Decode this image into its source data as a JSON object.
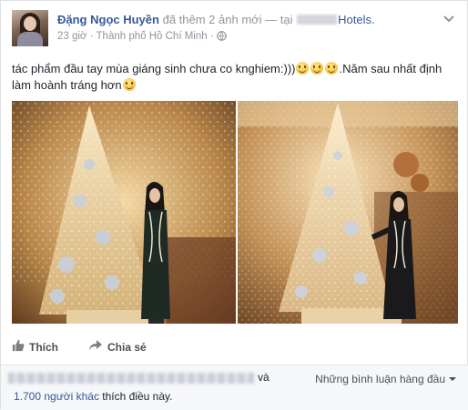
{
  "post": {
    "author": "Đặng Ngọc Huyền",
    "action_text": "đã thêm 2 ảnh mới — tại",
    "place": "Hotels.",
    "time": "23 giờ",
    "separator": "·",
    "location": "Thành phố Hồ Chí Minh",
    "privacy_icon": "globe-icon",
    "menu_icon": "chevron-down-icon",
    "text_part1": "tác phẩm đầu tay mùa giáng sinh chưa co knghiem:)))",
    "text_part2": ".Năm sau nhất định làm hoành tráng hơn",
    "emoji_icon": "grin-emoji-icon"
  },
  "photos": [
    {
      "alt_icon": "photo-christmas-tree-1"
    },
    {
      "alt_icon": "photo-christmas-tree-2"
    }
  ],
  "actions": {
    "like_label": "Thích",
    "share_label": "Chia sẻ",
    "like_icon": "thumbs-up-icon",
    "share_icon": "share-arrow-icon"
  },
  "footer": {
    "and_text": "và",
    "sort_label": "Những bình luận hàng đầu",
    "likes_count_text": "1.700 người khác",
    "likes_suffix": " thích điều này."
  },
  "colors": {
    "link": "#365899",
    "muted": "#90949c",
    "text": "#1d2129",
    "footer_bg": "#f6f7f9"
  }
}
